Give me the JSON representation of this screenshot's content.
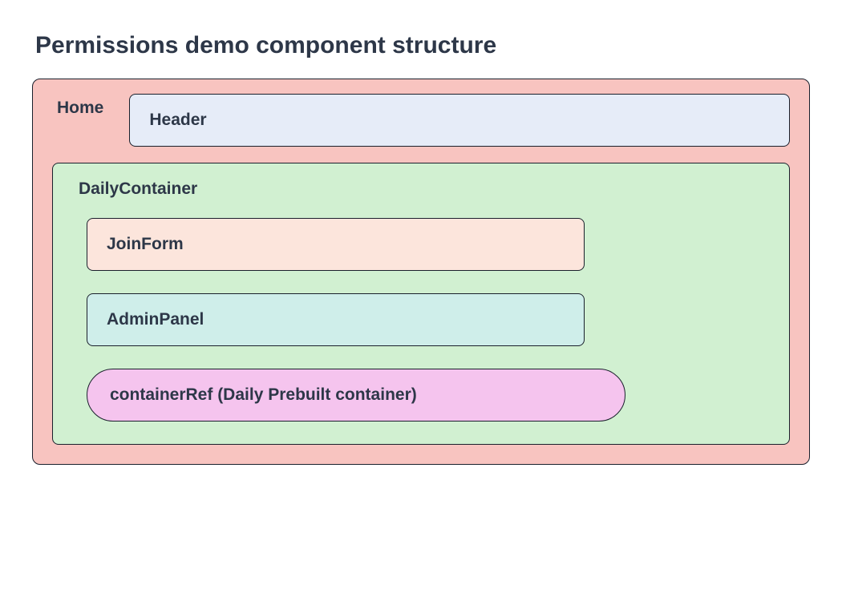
{
  "title": "Permissions demo component structure",
  "home": {
    "label": "Home",
    "header": {
      "label": "Header"
    },
    "dailyContainer": {
      "label": "DailyContainer",
      "joinForm": {
        "label": "JoinForm"
      },
      "adminPanel": {
        "label": "AdminPanel"
      },
      "containerRef": {
        "label": "containerRef (Daily Prebuilt container)"
      }
    }
  }
}
